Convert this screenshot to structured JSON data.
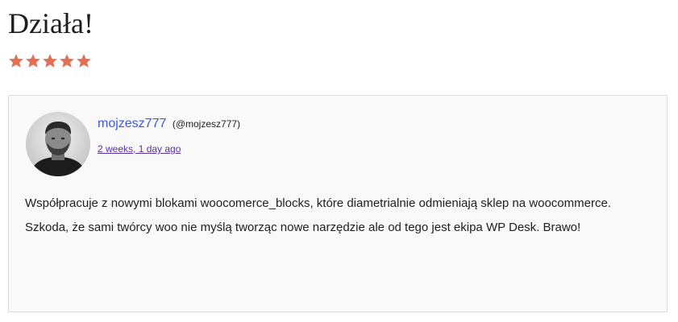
{
  "review": {
    "title": "Działa!",
    "rating": {
      "value": 5,
      "max": 5,
      "color": "#e26f56",
      "icon": "star-icon"
    },
    "author": {
      "name": "mojzesz777",
      "handle": "(@mojzesz777)",
      "link_color": "#3858e9"
    },
    "date": "2 weeks, 1 day ago",
    "body": "Współpracuje z nowymi blokami woocomerce_blocks, które diametrialnie odmieniają sklep na woocommerce. Szkoda, że sami twórcy woo nie myślą tworząc nowe narzędzie ale od tego jest ekipa WP Desk. Brawo!"
  }
}
